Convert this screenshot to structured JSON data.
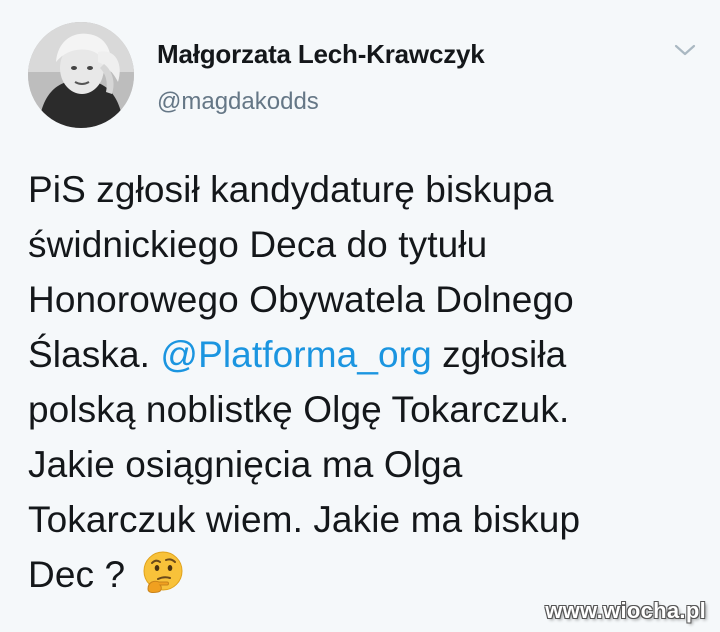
{
  "author": {
    "name": "Małgorzata Lech-Krawczyk",
    "handle": "@magdakodds",
    "avatar_icon": "avatar-photo"
  },
  "menu_icon": "chevron-down-icon",
  "tweet": {
    "line1": "PiS zgłosił kandydaturę biskupa",
    "line2": "świdnickiego Deca do tytułu",
    "line3": "Honorowego Obywatela Dolnego",
    "line4_before": "Ślaska. ",
    "mention": "@Platforma_org",
    "line4_after": " zgłosiła",
    "line5": "polską noblistkę Olgę Tokarczuk.",
    "line6": "Jakie osiągnięcia ma Olga",
    "line7": "Tokarczuk wiem. Jakie ma biskup",
    "line8": "Dec ? ",
    "emoji": "thinking-face-emoji"
  },
  "colors": {
    "background": "#f5f8fa",
    "text": "#14171a",
    "secondary": "#657786",
    "link": "#1b95e0"
  },
  "watermark": "www.wiocha.pl"
}
